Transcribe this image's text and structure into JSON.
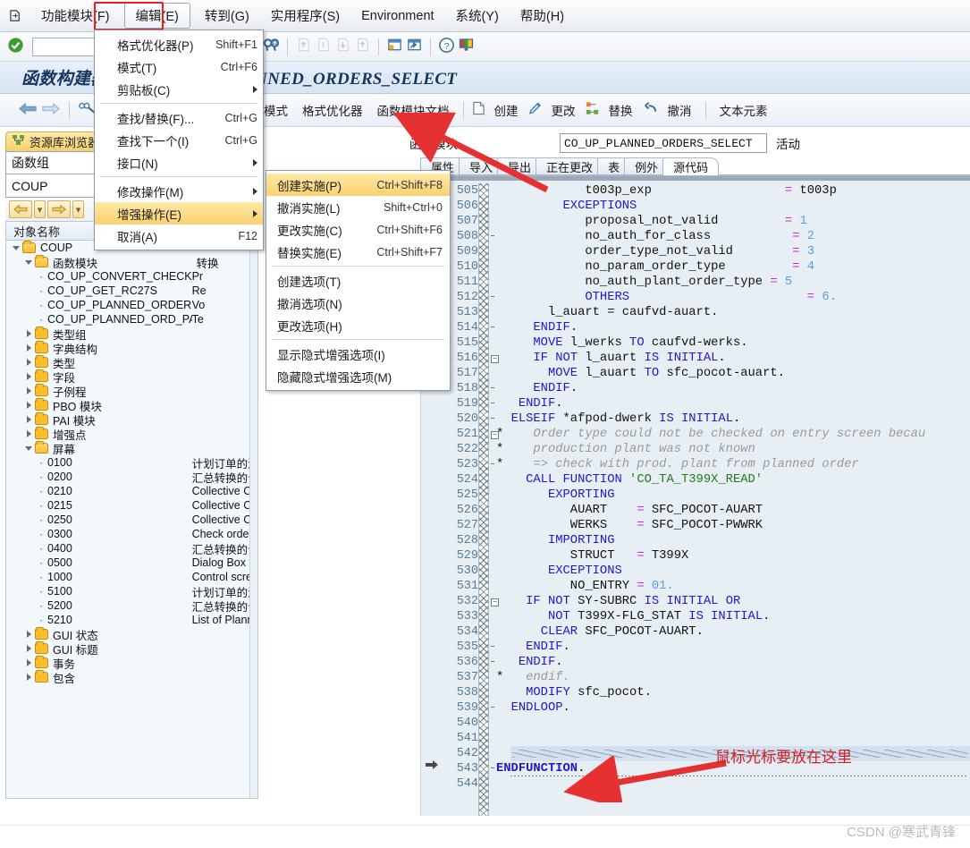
{
  "menubar": {
    "system_icon": "system-menu-icon",
    "items": [
      {
        "label": "功能模块(F)",
        "name": "menu-function-module"
      },
      {
        "label": "编辑(E)",
        "name": "menu-edit",
        "active": true
      },
      {
        "label": "转到(G)",
        "name": "menu-goto"
      },
      {
        "label": "实用程序(S)",
        "name": "menu-utilities"
      },
      {
        "label": "Environment",
        "name": "menu-environment"
      },
      {
        "label": "系统(Y)",
        "name": "menu-system"
      },
      {
        "label": "帮助(H)",
        "name": "menu-help"
      }
    ]
  },
  "toolbar_std": {
    "command_value": "",
    "command_placeholder": "",
    "icons": [
      "check-icon",
      "cancel-icon",
      "print-icon",
      "find-icon",
      "find-next-icon",
      "first-page-icon",
      "previous-page-icon",
      "next-page-icon",
      "last-page-icon",
      "new-session-icon",
      "create-shortcut-icon",
      "help-icon",
      "customize-layout-icon"
    ]
  },
  "title": {
    "text": "函数构建器: 显示 CO_UP_PLANNED_ORDERS_SELECT"
  },
  "toolbar_app": {
    "buttons": [
      {
        "label": "模式",
        "name": "toolbar-pattern-button"
      },
      {
        "label": "格式优化器",
        "name": "toolbar-pretty-printer-button"
      },
      {
        "label": "函数模块文档",
        "name": "toolbar-fm-documentation-button"
      },
      {
        "label": "创建",
        "name": "toolbar-create-button"
      },
      {
        "label": "更改",
        "name": "toolbar-change-button"
      },
      {
        "label": "替换",
        "name": "toolbar-replace-button"
      },
      {
        "label": "撤消",
        "name": "toolbar-undo-button"
      },
      {
        "label": "文本元素",
        "name": "toolbar-text-elements-button"
      }
    ]
  },
  "left_panel": {
    "repository_browser_tab": "资源库浏览器",
    "function_group_label": "函数组",
    "function_group_value": "COUP",
    "tree_header_col1": "对象名称",
    "tree_header_col2": "描述",
    "tree": [
      {
        "label": "COUP",
        "desc": "",
        "indent": 0,
        "type": "folder-open"
      },
      {
        "label": "函数模块",
        "desc": "转换",
        "indent": 1,
        "type": "folder-open"
      },
      {
        "label": "CO_UP_CONVERT_CHECK_AVAIL",
        "desc": "Pr",
        "indent": 2,
        "type": "leaf"
      },
      {
        "label": "CO_UP_GET_RC27S",
        "desc": "Re",
        "indent": 2,
        "type": "leaf"
      },
      {
        "label": "CO_UP_PLANNED_ORDERS_SELECT",
        "desc": "Vo",
        "indent": 2,
        "type": "leaf"
      },
      {
        "label": "CO_UP_PLANNED_ORD_PARTIAL_CON",
        "desc": "Te",
        "indent": 2,
        "type": "leaf"
      },
      {
        "label": "类型组",
        "desc": "",
        "indent": 1,
        "type": "folder"
      },
      {
        "label": "字典结构",
        "desc": "",
        "indent": 1,
        "type": "folder"
      },
      {
        "label": "类型",
        "desc": "",
        "indent": 1,
        "type": "folder"
      },
      {
        "label": "字段",
        "desc": "",
        "indent": 1,
        "type": "folder"
      },
      {
        "label": "子例程",
        "desc": "",
        "indent": 1,
        "type": "folder"
      },
      {
        "label": "PBO 模块",
        "desc": "",
        "indent": 1,
        "type": "folder"
      },
      {
        "label": "PAI 模块",
        "desc": "",
        "indent": 1,
        "type": "folder"
      },
      {
        "label": "增强点",
        "desc": "",
        "indent": 1,
        "type": "folder"
      },
      {
        "label": "屏幕",
        "desc": "",
        "indent": 1,
        "type": "folder-open"
      },
      {
        "label": "0100",
        "desc": "计划订单的汇总转换初始屏幕",
        "indent": 2,
        "type": "leaf"
      },
      {
        "label": "0200",
        "desc": "汇总转换的计划订单清单",
        "indent": 2,
        "type": "leaf"
      },
      {
        "label": "0210",
        "desc": "Collective Conversion of Planne",
        "indent": 2,
        "type": "leaf"
      },
      {
        "label": "0215",
        "desc": "Collective Conversion: Dummy S",
        "indent": 2,
        "type": "leaf"
      },
      {
        "label": "0250",
        "desc": "Collective Conversion: Initial Scr",
        "indent": 2,
        "type": "leaf"
      },
      {
        "label": "0300",
        "desc": "Check order  type / order num",
        "indent": 2,
        "type": "leaf"
      },
      {
        "label": "0400",
        "desc": "汇总转换的订单选择参数",
        "indent": 2,
        "type": "leaf"
      },
      {
        "label": "0500",
        "desc": "Dialog Box for Processing Sort I",
        "indent": 2,
        "type": "leaf"
      },
      {
        "label": "1000",
        "desc": "Control screen for partial reduc",
        "indent": 2,
        "type": "leaf"
      },
      {
        "label": "5100",
        "desc": "计划订单的汇总转换初始屏幕",
        "indent": 2,
        "type": "leaf"
      },
      {
        "label": "5200",
        "desc": "汇总转换的计划订单的清单",
        "indent": 2,
        "type": "leaf"
      },
      {
        "label": "5210",
        "desc": "List of Planned Orders for Colle",
        "indent": 2,
        "type": "leaf"
      },
      {
        "label": "GUI 状态",
        "desc": "",
        "indent": 1,
        "type": "folder"
      },
      {
        "label": "GUI 标题",
        "desc": "",
        "indent": 1,
        "type": "folder"
      },
      {
        "label": "事务",
        "desc": "",
        "indent": 1,
        "type": "folder"
      },
      {
        "label": "包含",
        "desc": "",
        "indent": 1,
        "type": "folder"
      }
    ]
  },
  "function_module": {
    "label": "函数模块",
    "value": "CO_UP_PLANNED_ORDERS_SELECT",
    "status": "活动",
    "tabs": [
      {
        "label": "属性",
        "name": "tab-attributes",
        "selected": false
      },
      {
        "label": "导入",
        "name": "tab-import",
        "selected": false
      },
      {
        "label": "导出",
        "name": "tab-export",
        "selected": false
      },
      {
        "label": "正在更改",
        "name": "tab-changing",
        "selected": false
      },
      {
        "label": "表",
        "name": "tab-tables",
        "selected": false
      },
      {
        "label": "例外",
        "name": "tab-exceptions",
        "selected": false
      },
      {
        "label": "源代码",
        "name": "tab-source-code",
        "selected": true
      }
    ]
  },
  "edit_menu": {
    "items": [
      {
        "label": "格式优化器(P)",
        "accel": "Shift+F1",
        "submenu": false,
        "name": "menuitem-pretty-printer"
      },
      {
        "label": "模式(T)",
        "accel": "Ctrl+F6",
        "submenu": false,
        "name": "menuitem-pattern"
      },
      {
        "label": "剪贴板(C)",
        "accel": "",
        "submenu": true,
        "name": "menuitem-clipboard"
      },
      {
        "sep": true
      },
      {
        "label": "查找/替换(F)...",
        "accel": "Ctrl+G",
        "submenu": false,
        "name": "menuitem-find-replace"
      },
      {
        "label": "查找下一个(I)",
        "accel": "Ctrl+G",
        "submenu": false,
        "name": "menuitem-find-next"
      },
      {
        "label": "接口(N)",
        "accel": "",
        "submenu": true,
        "name": "menuitem-interface"
      },
      {
        "sep": true
      },
      {
        "label": "修改操作(M)",
        "accel": "",
        "submenu": true,
        "name": "menuitem-modification-operations"
      },
      {
        "label": "增强操作(E)",
        "accel": "",
        "submenu": true,
        "name": "menuitem-enhancement-operations",
        "highlighted": true
      },
      {
        "label": "取消(A)",
        "accel": "F12",
        "submenu": false,
        "name": "menuitem-cancel"
      }
    ]
  },
  "enhancement_submenu": {
    "items": [
      {
        "label": "创建实施(P)",
        "accel": "Ctrl+Shift+F8",
        "highlighted": true,
        "name": "submenuitem-create-implementation"
      },
      {
        "label": "撤消实施(L)",
        "accel": "Shift+Ctrl+0",
        "name": "submenuitem-delete-implementation"
      },
      {
        "label": "更改实施(C)",
        "accel": "Ctrl+Shift+F6",
        "name": "submenuitem-change-implementation"
      },
      {
        "label": "替换实施(E)",
        "accel": "Ctrl+Shift+F7",
        "name": "submenuitem-replace-implementation"
      },
      {
        "sep": true
      },
      {
        "label": "创建选项(T)",
        "accel": "",
        "name": "submenuitem-create-option"
      },
      {
        "label": "撤消选项(N)",
        "accel": "",
        "name": "submenuitem-delete-option"
      },
      {
        "label": "更改选项(H)",
        "accel": "",
        "name": "submenuitem-change-option"
      },
      {
        "sep": true
      },
      {
        "label": "显示隐式增强选项(I)",
        "accel": "",
        "name": "submenuitem-show-implicit-enhancements"
      },
      {
        "label": "隐藏隐式增强选项(M)",
        "accel": "",
        "name": "submenuitem-hide-implicit-enhancements"
      }
    ]
  },
  "editor": {
    "first_line_number": 505,
    "lines": [
      {
        "n": 505,
        "text": "            t003p_exp                  = t003p"
      },
      {
        "n": 506,
        "text": "         EXCEPTIONS"
      },
      {
        "n": 507,
        "text": "            proposal_not_valid         = 1"
      },
      {
        "n": 508,
        "text": "            no_auth_for_class           = 2"
      },
      {
        "n": 509,
        "text": "            order_type_not_valid        = 3"
      },
      {
        "n": 510,
        "text": "            no_param_order_type         = 4"
      },
      {
        "n": 511,
        "text": "            no_auth_plant_order_type = 5"
      },
      {
        "n": 512,
        "text": "            OTHERS                        = 6."
      },
      {
        "n": 513,
        "text": "       l_auart = caufvd-auart."
      },
      {
        "n": 514,
        "text": "     ENDIF."
      },
      {
        "n": 515,
        "text": "     MOVE l_werks TO caufvd-werks."
      },
      {
        "n": 516,
        "text": "     IF NOT l_auart IS INITIAL."
      },
      {
        "n": 517,
        "text": "       MOVE l_auart TO sfc_pocot-auart."
      },
      {
        "n": 518,
        "text": "     ENDIF."
      },
      {
        "n": 519,
        "text": "   ENDIF."
      },
      {
        "n": 520,
        "text": "  ELSEIF *afpod-dwerk IS INITIAL."
      },
      {
        "n": 521,
        "text": "*    Order type could not be checked on entry screen becau"
      },
      {
        "n": 522,
        "text": "*    production plant was not known"
      },
      {
        "n": 523,
        "text": "*    => check with prod. plant from planned order"
      },
      {
        "n": 524,
        "text": "    CALL FUNCTION 'CO_TA_T399X_READ'"
      },
      {
        "n": 525,
        "text": "       EXPORTING"
      },
      {
        "n": 526,
        "text": "          AUART    = SFC_POCOT-AUART"
      },
      {
        "n": 527,
        "text": "          WERKS    = SFC_POCOT-PWWRK"
      },
      {
        "n": 528,
        "text": "       IMPORTING"
      },
      {
        "n": 529,
        "text": "          STRUCT   = T399X"
      },
      {
        "n": 530,
        "text": "       EXCEPTIONS"
      },
      {
        "n": 531,
        "text": "          NO_ENTRY = 01."
      },
      {
        "n": 532,
        "text": "    IF NOT SY-SUBRC IS INITIAL OR"
      },
      {
        "n": 533,
        "text": "       NOT T399X-FLG_STAT IS INITIAL."
      },
      {
        "n": 534,
        "text": "      CLEAR SFC_POCOT-AUART."
      },
      {
        "n": 535,
        "text": "    ENDIF."
      },
      {
        "n": 536,
        "text": "   ENDIF."
      },
      {
        "n": 537,
        "text": "*   endif."
      },
      {
        "n": 538,
        "text": "    MODIFY sfc_pocot."
      },
      {
        "n": 539,
        "text": "  ENDLOOP."
      },
      {
        "n": 540,
        "text": ""
      },
      {
        "n": 541,
        "text": ""
      },
      {
        "n": 542,
        "text": ""
      },
      {
        "n": 543,
        "text": "ENDFUNCTION."
      },
      {
        "n": 544,
        "text": ""
      }
    ]
  },
  "annotations": {
    "cursor_hint": "鼠标光标要放在这里",
    "watermark": "CSDN @寒武青锋"
  }
}
